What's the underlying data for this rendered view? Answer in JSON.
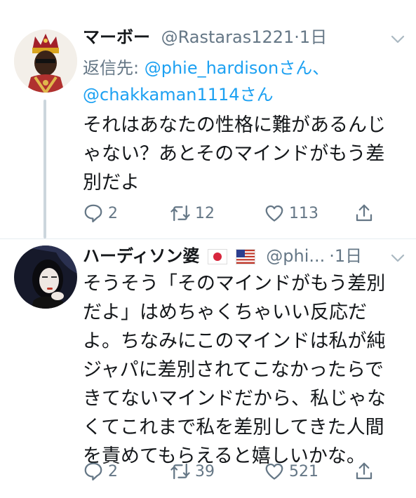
{
  "tweets": [
    {
      "name": "マーボー",
      "handle": "@Rastaras1221",
      "dot": "·",
      "time": "1日",
      "reply_prefix": "返信先: ",
      "reply_user1": "@phie_hardisonさん、",
      "reply_user2": "@chakkaman1114さん",
      "lines": [
        "それはあなたの性格に難があるんじ",
        "ゃない？あとそのマインドがもう差",
        "別だよ"
      ],
      "replies": "2",
      "retweets": "12",
      "likes": "113",
      "icons": {
        "avatar": "king-avatar",
        "reply": "reply-icon",
        "retweet": "retweet-icon",
        "like": "heart-icon",
        "share": "share-icon",
        "menu": "chevron-down-icon"
      }
    },
    {
      "name": "ハーディソン婆",
      "flags": [
        "japan-flag",
        "usa-flag"
      ],
      "handle": "@phi...",
      "dot": "·",
      "time": "1日",
      "lines": [
        "そうそう「そのマインドがもう差別",
        "だよ」はめちゃくちゃいい反応だ",
        "よ。ちなみにこのマインドは私が純",
        "ジャパに差別されてこなかったらで",
        "きてないマインドだから、私じゃな",
        "くてこれまで私を差別してきた人間",
        "を責めてもらえると嬉しいかな。"
      ],
      "replies": "2",
      "retweets": "39",
      "likes": "521"
    }
  ],
  "colors": {
    "text": "#14171a",
    "secondary": "#657786",
    "link": "#1da1f2",
    "divider": "#e6ecf0",
    "thread": "#ccd6dd"
  }
}
